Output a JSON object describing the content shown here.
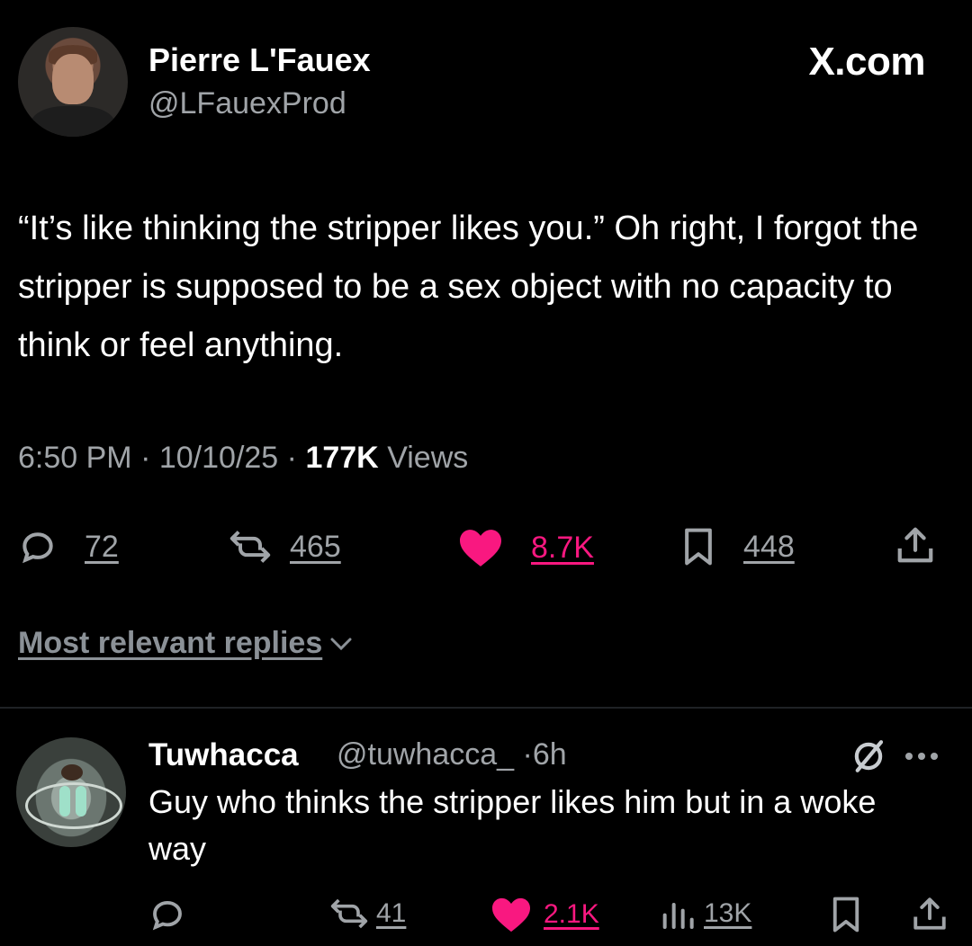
{
  "post": {
    "author_name": "Pierre L'Fauex",
    "author_handle": "@LFauexProd",
    "brand": "X.com",
    "text": "“It’s like thinking the stripper likes you.” Oh right, I forgot the stripper is supposed to be a sex object with no capacity to think or feel anything.",
    "time": "6:50 PM",
    "date": "10/10/25",
    "views_count": "177K",
    "views_label": "Views",
    "separator": "·",
    "replies": "72",
    "reposts": "465",
    "likes": "8.7K",
    "bookmarks": "448",
    "liked": true,
    "like_color": "#f91880"
  },
  "replies_header": {
    "label": "Most relevant replies",
    "icon": "chevron-down-icon"
  },
  "reply": {
    "author_name": "Tuwhacca",
    "author_handle": "@tuwhacca_",
    "age": "6h",
    "separator": "·",
    "text": "Guy who thinks the stripper likes him but in a woke way",
    "reposts": "41",
    "likes": "2.1K",
    "views": "13K",
    "liked": true,
    "icons": [
      "grok-icon",
      "more-icon",
      "reply-icon",
      "repost-icon",
      "heart-icon",
      "analytics-icon",
      "bookmark-icon",
      "share-icon"
    ]
  },
  "colors": {
    "background": "#000000",
    "text_primary": "#ffffff",
    "text_secondary": "#a0a4a8",
    "like": "#f91880"
  }
}
